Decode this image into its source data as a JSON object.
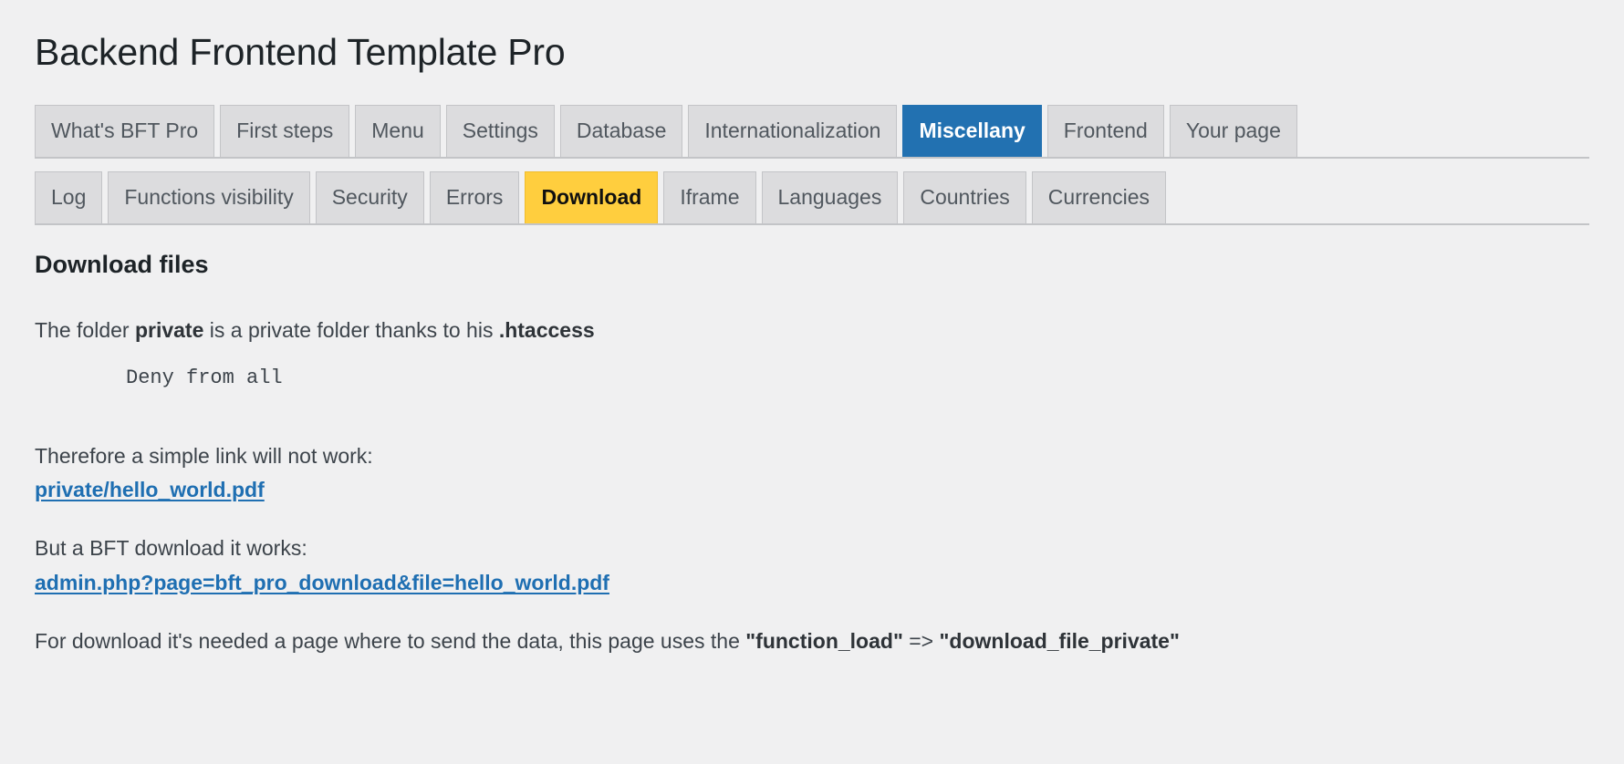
{
  "header": {
    "title": "Backend Frontend Template Pro"
  },
  "colors": {
    "page_background": "#f0f0f1",
    "tab_inactive_bg": "#dcdcde",
    "tab_border": "#c3c4c7",
    "primary_active_bg": "#2271b1",
    "primary_active_text": "#ffffff",
    "secondary_active_bg": "#ffce3e",
    "secondary_active_text": "#101010",
    "link": "#1f6fb2",
    "body_text": "#3c434a",
    "heading_text": "#1d2327"
  },
  "primary_tabs": [
    {
      "label": "What's BFT Pro",
      "active": false
    },
    {
      "label": "First steps",
      "active": false
    },
    {
      "label": "Menu",
      "active": false
    },
    {
      "label": "Settings",
      "active": false
    },
    {
      "label": "Database",
      "active": false
    },
    {
      "label": "Internationalization",
      "active": false
    },
    {
      "label": "Miscellany",
      "active": true
    },
    {
      "label": "Frontend",
      "active": false
    },
    {
      "label": "Your page",
      "active": false
    }
  ],
  "secondary_tabs": [
    {
      "label": "Log",
      "active": false
    },
    {
      "label": "Functions visibility",
      "active": false
    },
    {
      "label": "Security",
      "active": false
    },
    {
      "label": "Errors",
      "active": false
    },
    {
      "label": "Download",
      "active": true
    },
    {
      "label": "Iframe",
      "active": false
    },
    {
      "label": "Languages",
      "active": false
    },
    {
      "label": "Countries",
      "active": false
    },
    {
      "label": "Currencies",
      "active": false
    }
  ],
  "content": {
    "section_title": "Download files",
    "intro": {
      "part1": "The folder ",
      "bold1": "private",
      "part2": " is a private folder thanks to his ",
      "bold2": ".htaccess"
    },
    "code_snippet": "Deny from all",
    "lead_simple_link": "Therefore a simple link will not work:",
    "simple_link": "private/hello_world.pdf",
    "lead_bft_link": "But a BFT download it works:",
    "bft_link": "admin.php?page=bft_pro_download&file=hello_world.pdf",
    "final_note": {
      "part1": "For download it's needed a page where to send the data, this page uses the ",
      "bold1": "\"function_load\"",
      "part2": " => ",
      "bold2": "\"download_file_private\""
    }
  }
}
